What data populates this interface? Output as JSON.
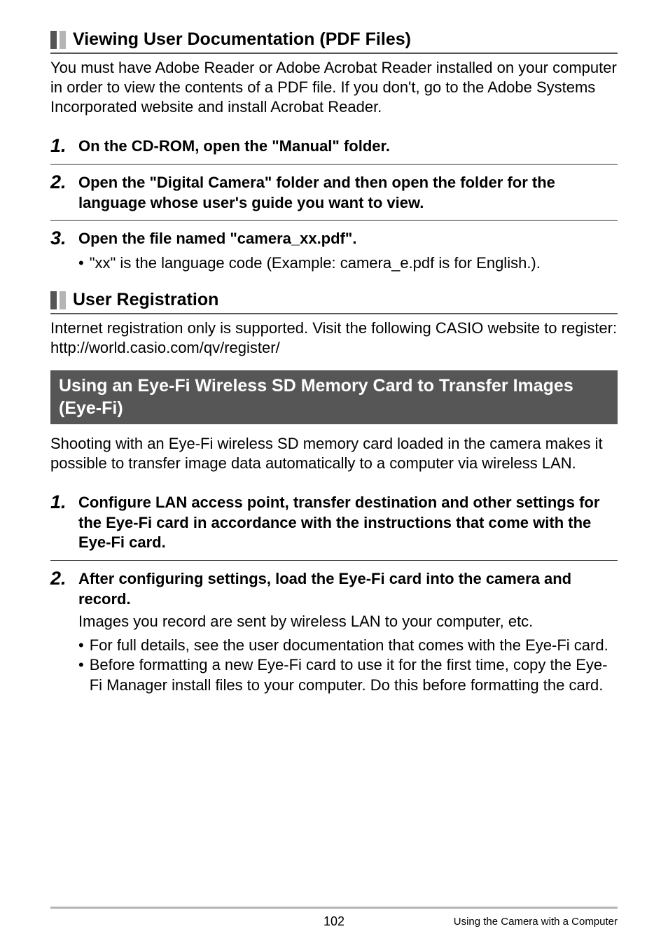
{
  "section1": {
    "heading": "Viewing User Documentation (PDF Files)",
    "intro": "You must have Adobe Reader or Adobe Acrobat Reader installed on your computer in order to view the contents of a PDF file. If you don't, go to the Adobe Systems Incorporated website and install Acrobat Reader.",
    "steps": [
      {
        "num": "1.",
        "title": "On the CD-ROM, open the \"Manual\" folder."
      },
      {
        "num": "2.",
        "title": "Open the \"Digital Camera\" folder and then open the folder for the language whose user's guide you want to view."
      },
      {
        "num": "3.",
        "title": "Open the file named \"camera_xx.pdf\".",
        "bullets": [
          "\"xx\" is the language code (Example: camera_e.pdf is for English.)."
        ]
      }
    ]
  },
  "section2": {
    "heading": "User Registration",
    "intro": "Internet registration only is supported. Visit the following CASIO website to register:\nhttp://world.casio.com/qv/register/"
  },
  "section3": {
    "heading": "Using an Eye-Fi Wireless SD Memory Card to Transfer Images (Eye-Fi)",
    "intro": "Shooting with an Eye-Fi wireless SD memory card loaded in the camera makes it possible to transfer image data automatically to a computer via wireless LAN.",
    "steps": [
      {
        "num": "1.",
        "title": "Configure LAN access point, transfer destination and other settings for the Eye-Fi card in accordance with the instructions that come with the Eye-Fi card."
      },
      {
        "num": "2.",
        "title": "After configuring settings, load the Eye-Fi card into the camera and record.",
        "sub": "Images you record are sent by wireless LAN to your computer, etc.",
        "bullets": [
          "For full details, see the user documentation that comes with the Eye-Fi card.",
          "Before formatting a new Eye-Fi card to use it for the first time, copy the Eye-Fi Manager install files to your computer. Do this before formatting the card."
        ]
      }
    ]
  },
  "footer": {
    "page": "102",
    "right": "Using the Camera with a Computer"
  }
}
